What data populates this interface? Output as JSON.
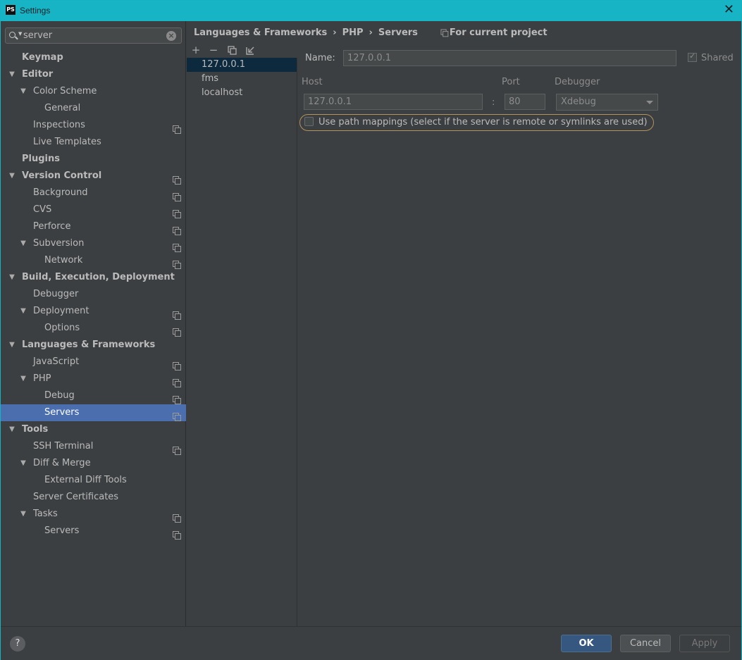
{
  "window": {
    "title": "Settings",
    "app_icon_text": "PS",
    "close_glyph": "✕"
  },
  "search": {
    "value": "server",
    "clear_glyph": "×"
  },
  "tree": [
    {
      "label": "Keymap",
      "level": 0,
      "bold": true,
      "expanded": null,
      "project": false,
      "selected": false
    },
    {
      "label": "Editor",
      "level": 0,
      "bold": true,
      "expanded": true,
      "project": false,
      "selected": false
    },
    {
      "label": "Color Scheme",
      "level": 1,
      "bold": false,
      "expanded": true,
      "project": false,
      "selected": false
    },
    {
      "label": "General",
      "level": 2,
      "bold": false,
      "expanded": null,
      "project": false,
      "selected": false
    },
    {
      "label": "Inspections",
      "level": 1,
      "bold": false,
      "expanded": null,
      "project": true,
      "selected": false
    },
    {
      "label": "Live Templates",
      "level": 1,
      "bold": false,
      "expanded": null,
      "project": false,
      "selected": false
    },
    {
      "label": "Plugins",
      "level": 0,
      "bold": true,
      "expanded": null,
      "project": false,
      "selected": false
    },
    {
      "label": "Version Control",
      "level": 0,
      "bold": true,
      "expanded": true,
      "project": true,
      "selected": false
    },
    {
      "label": "Background",
      "level": 1,
      "bold": false,
      "expanded": null,
      "project": true,
      "selected": false
    },
    {
      "label": "CVS",
      "level": 1,
      "bold": false,
      "expanded": null,
      "project": true,
      "selected": false
    },
    {
      "label": "Perforce",
      "level": 1,
      "bold": false,
      "expanded": null,
      "project": true,
      "selected": false
    },
    {
      "label": "Subversion",
      "level": 1,
      "bold": false,
      "expanded": true,
      "project": true,
      "selected": false
    },
    {
      "label": "Network",
      "level": 2,
      "bold": false,
      "expanded": null,
      "project": true,
      "selected": false
    },
    {
      "label": "Build, Execution, Deployment",
      "level": 0,
      "bold": true,
      "expanded": true,
      "project": false,
      "selected": false
    },
    {
      "label": "Debugger",
      "level": 1,
      "bold": false,
      "expanded": null,
      "project": false,
      "selected": false
    },
    {
      "label": "Deployment",
      "level": 1,
      "bold": false,
      "expanded": true,
      "project": true,
      "selected": false
    },
    {
      "label": "Options",
      "level": 2,
      "bold": false,
      "expanded": null,
      "project": true,
      "selected": false
    },
    {
      "label": "Languages & Frameworks",
      "level": 0,
      "bold": true,
      "expanded": true,
      "project": false,
      "selected": false
    },
    {
      "label": "JavaScript",
      "level": 1,
      "bold": false,
      "expanded": null,
      "project": true,
      "selected": false
    },
    {
      "label": "PHP",
      "level": 1,
      "bold": false,
      "expanded": true,
      "project": true,
      "selected": false
    },
    {
      "label": "Debug",
      "level": 2,
      "bold": false,
      "expanded": null,
      "project": true,
      "selected": false
    },
    {
      "label": "Servers",
      "level": 2,
      "bold": false,
      "expanded": null,
      "project": true,
      "selected": true
    },
    {
      "label": "Tools",
      "level": 0,
      "bold": true,
      "expanded": true,
      "project": false,
      "selected": false
    },
    {
      "label": "SSH Terminal",
      "level": 1,
      "bold": false,
      "expanded": null,
      "project": true,
      "selected": false
    },
    {
      "label": "Diff & Merge",
      "level": 1,
      "bold": false,
      "expanded": true,
      "project": false,
      "selected": false
    },
    {
      "label": "External Diff Tools",
      "level": 2,
      "bold": false,
      "expanded": null,
      "project": false,
      "selected": false
    },
    {
      "label": "Server Certificates",
      "level": 1,
      "bold": false,
      "expanded": null,
      "project": false,
      "selected": false
    },
    {
      "label": "Tasks",
      "level": 1,
      "bold": false,
      "expanded": true,
      "project": true,
      "selected": false
    },
    {
      "label": "Servers",
      "level": 2,
      "bold": false,
      "expanded": null,
      "project": true,
      "selected": false
    }
  ],
  "breadcrumb": {
    "items": [
      "Languages & Frameworks",
      "PHP",
      "Servers"
    ],
    "separator": "›",
    "scope": "For current project"
  },
  "server_toolbar": {
    "add": "+",
    "remove": "−",
    "copy_icon": "copy-icon",
    "import_icon": "import-icon"
  },
  "servers": [
    {
      "name": "127.0.0.1",
      "selected": true
    },
    {
      "name": "fms",
      "selected": false
    },
    {
      "name": "localhost",
      "selected": false
    }
  ],
  "form": {
    "name_label": "Name:",
    "name_value": "127.0.0.1",
    "shared_label": "Shared",
    "shared_checked": true,
    "host_label": "Host",
    "host_value": "127.0.0.1",
    "port_label": "Port",
    "port_value": "80",
    "port_separator": ":",
    "debugger_label": "Debugger",
    "debugger_value": "Xdebug",
    "path_mappings_label": "Use path mappings (select if the server is remote or symlinks are used)",
    "path_mappings_checked": false
  },
  "footer": {
    "help": "?",
    "ok": "OK",
    "cancel": "Cancel",
    "apply": "Apply"
  },
  "colors": {
    "titlebar": "#17b4c6",
    "selection": "#4b6eaf",
    "ok_button": "#365880",
    "highlight_ring": "#b5935a"
  }
}
